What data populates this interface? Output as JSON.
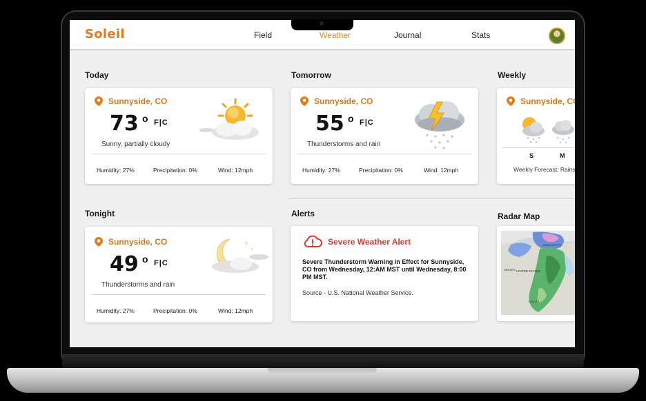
{
  "nav": {
    "brand": "Soleil",
    "items": [
      "Field",
      "Weather",
      "Journal",
      "Stats"
    ],
    "active_color": "#e8891f"
  },
  "sections": {
    "today": "Today",
    "tomorrow": "Tomorrow",
    "weekly": "Weekly",
    "tonight": "Tonight",
    "alerts": "Alerts",
    "radar": "Radar Map"
  },
  "today": {
    "location": "Sunnyside, CO",
    "temp": "73",
    "deg": "o",
    "units": "F|C",
    "condition": "Sunny, partially cloudy",
    "humidity": "Humidity: 27%",
    "precipitation": "Precipitation: 0%",
    "wind": "Wind: 12mph",
    "icon": "sun-cloud-icon"
  },
  "tomorrow": {
    "location": "Sunnyside, CO",
    "temp": "55",
    "deg": "o",
    "units": "F|C",
    "condition": "Thunderstorms and rain",
    "humidity": "Humidity: 27%",
    "precipitation": "Precipitation: 0%",
    "wind": "Wind: 12mph",
    "icon": "thunderstorm-icon"
  },
  "tonight": {
    "location": "Sunnyside, CO",
    "temp": "49",
    "deg": "o",
    "units": "F|C",
    "condition": "Thunderstorms and rain",
    "humidity": "Humidity: 27%",
    "precipitation": "Precipitation: 0%",
    "wind": "Wind: 12mph",
    "icon": "moon-cloud-icon"
  },
  "weekly": {
    "location": "Sunnyside, CO",
    "days": [
      "S",
      "M"
    ],
    "note": "Weekly Forecast: Rains"
  },
  "alert": {
    "title": "Severe Weather Alert",
    "body": "Severe Thunderstorm Warning in Effect for Sunnyside, CO from Wednesday, 12:AM MST until Wednesday, 8:00 PM MST.",
    "source": "Source - U.S. National Weather Service.",
    "color": "#e03a2e"
  },
  "radar": {
    "labels": [
      "UNITED STATES",
      "MINNEAPOLIS",
      "DALLAS",
      "DENVER"
    ]
  },
  "colors": {
    "accent": "#e07a1f"
  }
}
